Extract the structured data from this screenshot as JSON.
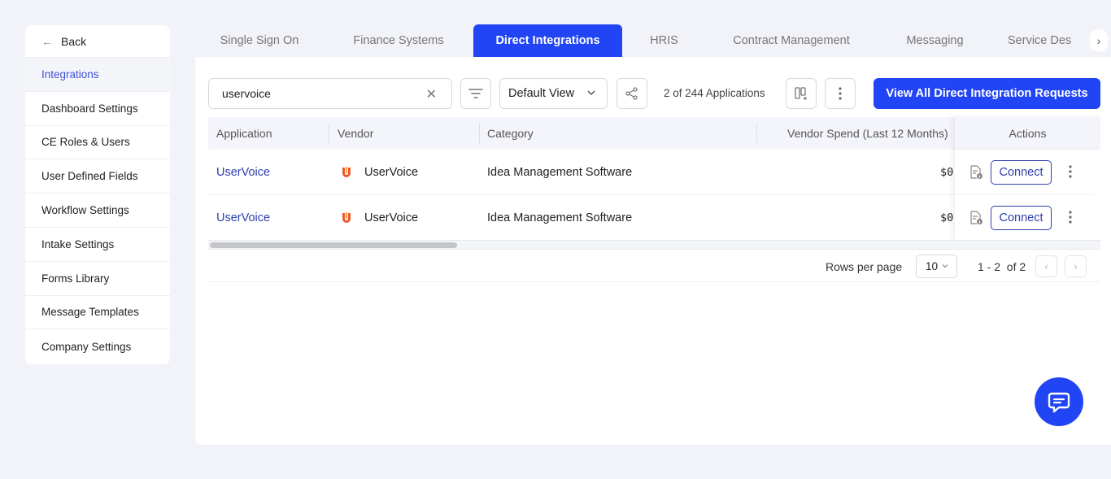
{
  "sidebar": {
    "back_label": "Back",
    "items": [
      {
        "label": "Integrations",
        "active": true
      },
      {
        "label": "Dashboard Settings"
      },
      {
        "label": "CE Roles & Users"
      },
      {
        "label": "User Defined Fields"
      },
      {
        "label": "Workflow Settings"
      },
      {
        "label": "Intake Settings"
      },
      {
        "label": "Forms Library"
      },
      {
        "label": "Message Templates"
      },
      {
        "label": "Company Settings"
      }
    ]
  },
  "tabs": [
    {
      "label": "Single Sign On"
    },
    {
      "label": "Finance Systems"
    },
    {
      "label": "Direct Integrations",
      "active": true
    },
    {
      "label": "HRIS"
    },
    {
      "label": "Contract Management"
    },
    {
      "label": "Messaging"
    },
    {
      "label": "Service Des"
    }
  ],
  "toolbar": {
    "search_value": "uservoice",
    "view_label": "Default View",
    "count_text": "2 of 244 Applications",
    "primary_button": "View All Direct Integration Requests"
  },
  "table": {
    "columns": [
      "Application",
      "Vendor",
      "Category",
      "Vendor Spend (Last 12 Months)",
      "Actions"
    ],
    "rows": [
      {
        "application": "UserVoice",
        "vendor": "UserVoice",
        "category": "Idea Management Software",
        "spend": "$0",
        "action": "Connect"
      },
      {
        "application": "UserVoice",
        "vendor": "UserVoice",
        "category": "Idea Management Software",
        "spend": "$0",
        "action": "Connect"
      }
    ]
  },
  "pagination": {
    "rows_per_page_label": "Rows per page",
    "rows_per_page": "10",
    "range": "1 - 2",
    "of_text": "of 2"
  },
  "colors": {
    "accent": "#2145f5",
    "link": "#2d3fae",
    "vendor_logo": "#f0582c"
  }
}
